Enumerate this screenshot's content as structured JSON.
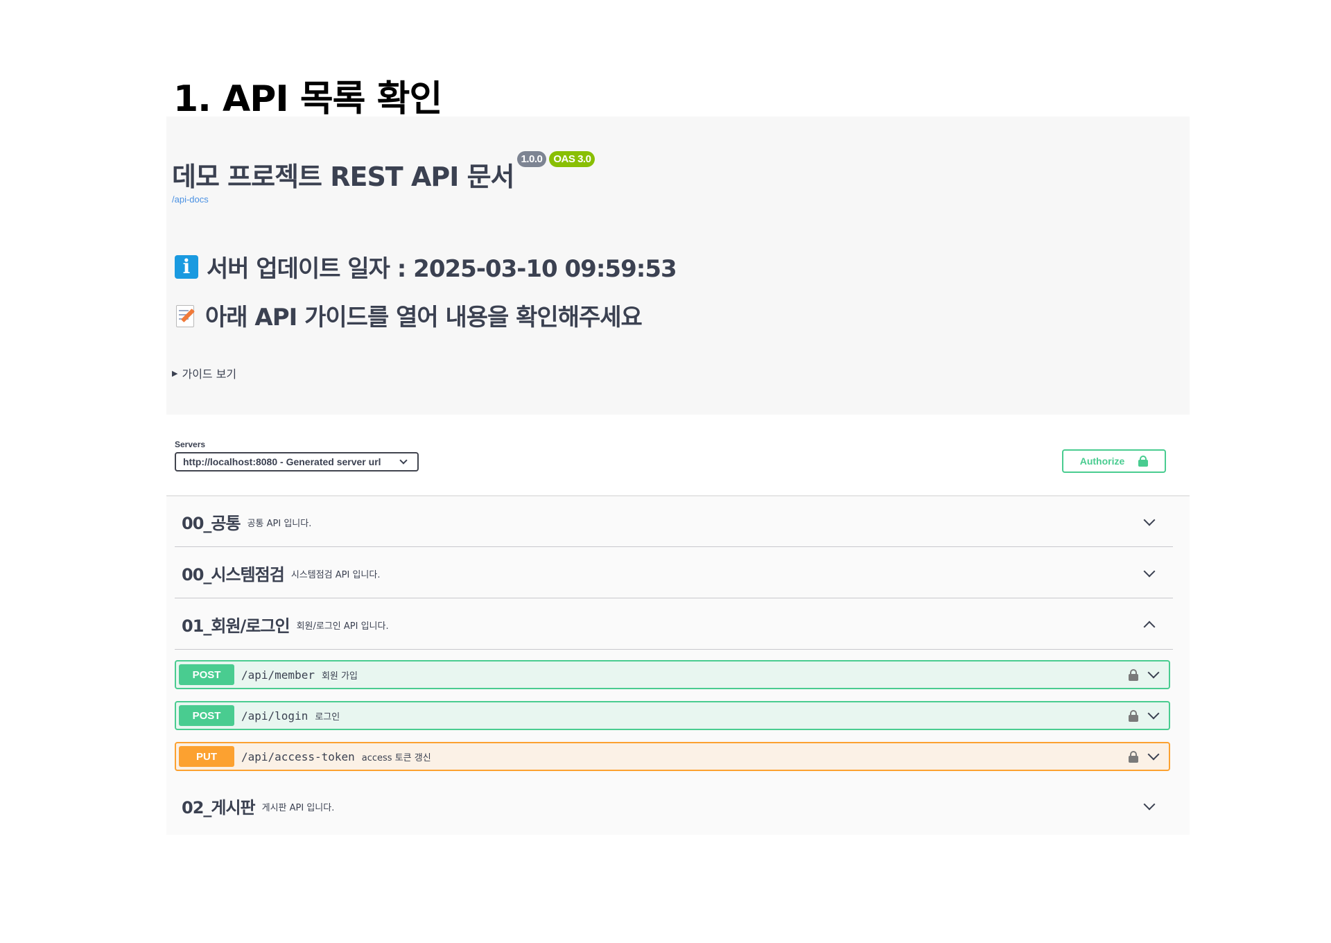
{
  "page_heading": "1. API 목록 확인",
  "info": {
    "title": "데모 프로젝트 REST API 문서",
    "version_badge": "1.0.0",
    "oas_badge": "OAS 3.0",
    "docs_link": "/api-docs",
    "update_line": "서버 업데이트 일자 : 2025-03-10 09:59:53",
    "guide_line": "아래 API 가이드를 열어 내용을 확인해주세요",
    "guide_toggle": "가이드 보기"
  },
  "servers": {
    "label": "Servers",
    "selected": "http://localhost:8080 - Generated server url"
  },
  "authorize_label": "Authorize",
  "colors": {
    "post": "#49cc90",
    "put": "#fca130",
    "link": "#4990e2",
    "version_badge": "#7d8492",
    "oas_badge": "#89bf04"
  },
  "tags": [
    {
      "name": "00_공통",
      "description": "공통 API 입니다.",
      "expanded": false
    },
    {
      "name": "00_시스템점검",
      "description": "시스템점검 API 입니다.",
      "expanded": false
    },
    {
      "name": "01_회원/로그인",
      "description": "회원/로그인 API 입니다.",
      "expanded": true
    },
    {
      "name": "02_게시판",
      "description": "게시판 API 입니다.",
      "expanded": false
    }
  ],
  "operations": [
    {
      "method": "POST",
      "path": "/api/member",
      "summary": "회원 가입",
      "locked": true
    },
    {
      "method": "POST",
      "path": "/api/login",
      "summary": "로그인",
      "locked": true
    },
    {
      "method": "PUT",
      "path": "/api/access-token",
      "summary": "access 토큰 갱신",
      "locked": true
    }
  ]
}
